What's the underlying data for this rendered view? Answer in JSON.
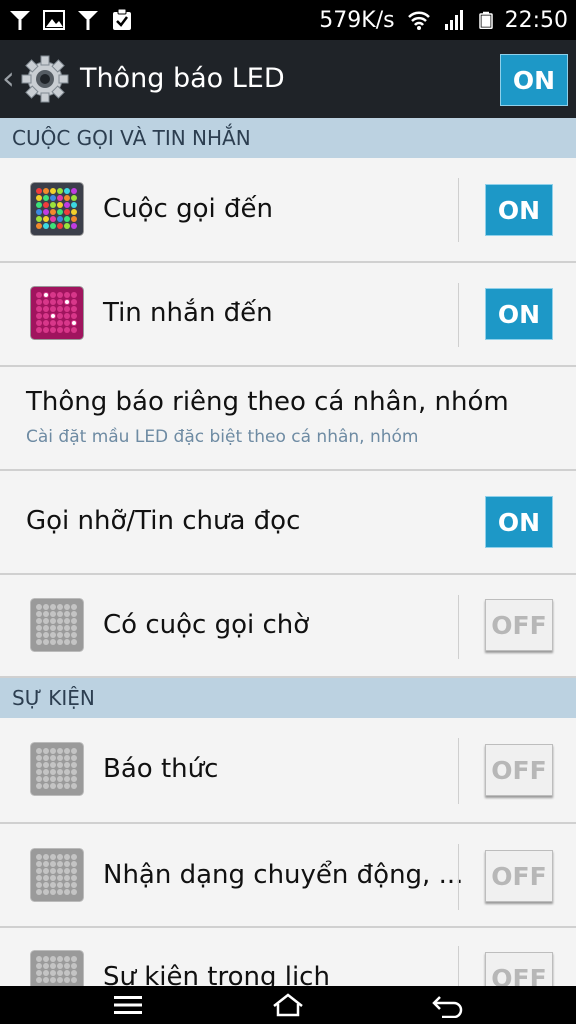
{
  "status_bar": {
    "speed": "579K/s",
    "time": "22:50",
    "left_icons": [
      "wifi-signal-icon",
      "image-icon",
      "wifi-signal-icon",
      "clipboard-check-icon"
    ],
    "right_icons": [
      "wifi-icon",
      "cell-signal-icon",
      "battery-icon"
    ]
  },
  "action_bar": {
    "title": "Thông báo LED",
    "master_toggle": "ON"
  },
  "sections": {
    "calls": "CUỘC GỌI VÀ TIN NHẮN",
    "events": "SỰ KIỆN"
  },
  "items": [
    {
      "label": "Cuộc gọi đến",
      "toggle": "ON",
      "icon": "colorful-led-grid-icon"
    },
    {
      "label": "Tin nhắn đến",
      "toggle": "ON",
      "icon": "magenta-led-grid-icon"
    },
    {
      "label": "Thông báo riêng theo cá nhân, nhóm",
      "sublabel": "Cài đặt mầu LED đặc biệt theo cá nhân, nhóm"
    },
    {
      "label": "Gọi nhỡ/Tin chưa đọc",
      "toggle": "ON"
    },
    {
      "label": "Có cuộc gọi chờ",
      "toggle": "OFF",
      "icon": "gray-led-grid-icon"
    },
    {
      "label": "Báo thức",
      "toggle": "OFF",
      "icon": "gray-led-grid-icon"
    },
    {
      "label": "Nhận dạng chuyển động, ...",
      "toggle": "OFF",
      "icon": "gray-led-grid-icon"
    },
    {
      "label": "Sự kiện trong lịch",
      "toggle": "OFF",
      "icon": "gray-led-grid-icon"
    }
  ],
  "nav_bar": [
    "menu-icon",
    "home-icon",
    "back-icon"
  ]
}
